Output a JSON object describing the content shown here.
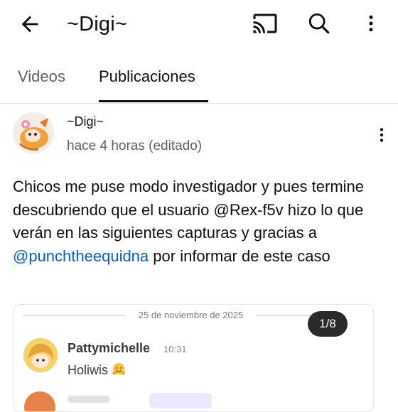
{
  "appbar": {
    "title": "~Digi~",
    "icons": [
      "arrow-back-icon",
      "cast-icon",
      "search-icon",
      "more-vert-icon"
    ]
  },
  "tabs": [
    {
      "label": "Videos",
      "selected": false
    },
    {
      "label": "Publicaciones",
      "selected": true
    }
  ],
  "post": {
    "author": "~Digi~",
    "timestamp": "hace 4 horas (editado)",
    "text_before_mention": "Chicos me puse modo investigador y pues termine descubriendo que el usuario @Rex-f5v hizo lo que verán en las siguientes capturas y gracias a ",
    "mention": "@punchtheequidna",
    "text_after_mention": " por informar de este caso",
    "image": {
      "counter": "1/8",
      "date": "25 de noviembre de 2025",
      "message": {
        "user": "Pattymichelle",
        "time": "10:31",
        "text": "Holiwis",
        "emoji": "hugging-face-emoji"
      }
    }
  },
  "colors": {
    "link": "#065fd4",
    "text_primary": "#0f0f0f",
    "text_secondary": "#606060",
    "counter_bg": "#2a2a2a"
  }
}
